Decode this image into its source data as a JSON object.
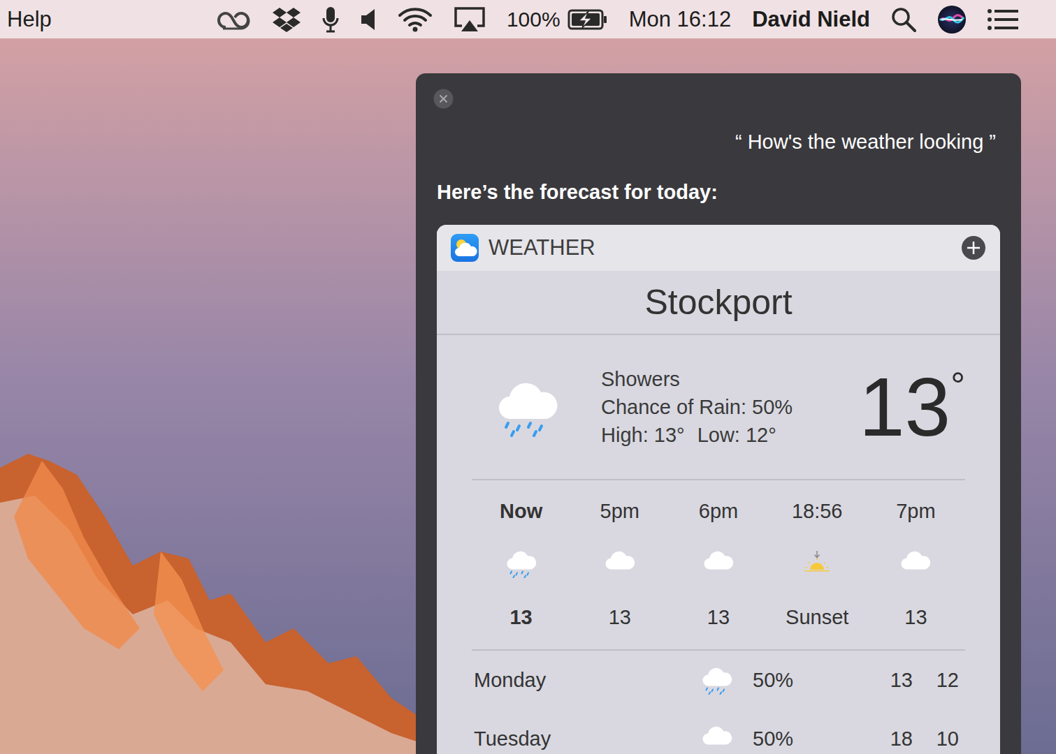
{
  "menu_bar": {
    "app_menu": "Help",
    "battery": "100%",
    "battery_charging": true,
    "clock": "Mon 16:12",
    "user": "David Nield"
  },
  "siri": {
    "query": "“ How's the weather looking ”",
    "response": "Here’s the forecast for today:"
  },
  "weather": {
    "title": "WEATHER",
    "city": "Stockport",
    "condition": "Showers",
    "chance": "Chance of Rain: 50%",
    "high": "High: 13°",
    "low": "Low: 12°",
    "temperature": "13",
    "degree": "°",
    "hourly": [
      {
        "label": "Now",
        "value": "13",
        "kind": "rain",
        "selected": true
      },
      {
        "label": "5pm",
        "value": "13",
        "kind": "cloud",
        "selected": false
      },
      {
        "label": "6pm",
        "value": "13",
        "kind": "cloud",
        "selected": false
      },
      {
        "label": "18:56",
        "value": "Sunset",
        "kind": "sunset",
        "selected": false
      },
      {
        "label": "7pm",
        "value": "13",
        "kind": "cloud",
        "selected": false
      }
    ],
    "daily": [
      {
        "day": "Monday",
        "kind": "rain",
        "chance": "50%",
        "high": "13",
        "low": "12"
      },
      {
        "day": "Tuesday",
        "kind": "cloud",
        "chance": "50%",
        "high": "18",
        "low": "10"
      }
    ]
  }
}
